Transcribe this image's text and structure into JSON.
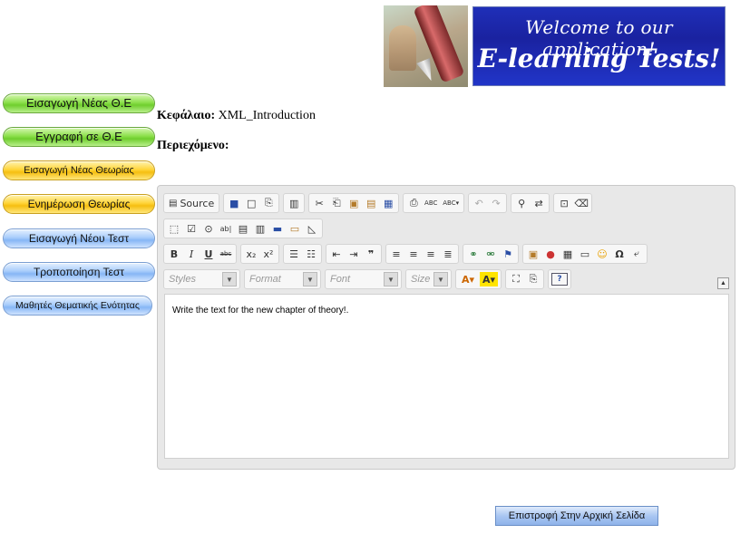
{
  "header": {
    "banner_line1": "Welcome to our application!",
    "banner_line2": "E-learning Tests!"
  },
  "sidebar": {
    "items": [
      {
        "label": "Εισαγωγή Νέας Θ.Ε",
        "color": "green"
      },
      {
        "label": "Εγγραφή σε Θ.Ε",
        "color": "green"
      },
      {
        "label": "Εισαγωγή Νέας Θεωρίας",
        "color": "yellow"
      },
      {
        "label": "Ενημέρωση Θεωρίας",
        "color": "yellow"
      },
      {
        "label": "Εισαγωγή Νέου Τεστ",
        "color": "blue"
      },
      {
        "label": "Τροποποίηση Τεστ",
        "color": "blue"
      },
      {
        "label": "Μαθητές Θεματικής Ενότητας",
        "color": "blue"
      }
    ]
  },
  "form": {
    "chapter_label": "Κεφάλαιο:",
    "chapter_value": "XML_Introduction",
    "content_label": "Περιεχόμενο:"
  },
  "editor": {
    "source_label": "Source",
    "styles": "Styles",
    "format": "Format",
    "font": "Font",
    "size": "Size",
    "content": "Write the text for the new chapter of theory!."
  },
  "footer": {
    "back_label": "Επιστροφή Στην Αρχική Σελίδα"
  },
  "colors": {
    "accent_green": "#8de04c",
    "accent_yellow": "#ffd53a",
    "accent_blue": "#a9cdfb",
    "banner_blue": "#1f2fb8"
  }
}
